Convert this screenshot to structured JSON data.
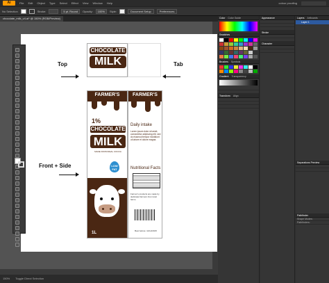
{
  "app": {
    "name": "Ai",
    "workspace_label": "colour proofing"
  },
  "menu": [
    "File",
    "Edit",
    "Object",
    "Type",
    "Select",
    "Effect",
    "View",
    "Window",
    "Help"
  ],
  "controlbar": {
    "selection": "No Selection",
    "stroke_label": "Stroke:",
    "stroke_value": "",
    "uniform_label": "5 pt. Round",
    "opacity_label": "Opacity:",
    "opacity_value": "100%",
    "style_label": "Style:",
    "doc_setup": "Document Setup",
    "preferences": "Preferences"
  },
  "document": {
    "tab_title": "chocolate_milk_v4.ai* @ 150% (RGB/Preview)"
  },
  "labels": {
    "top": "Top",
    "tab": "Tab",
    "front_side": "Front + Side"
  },
  "package": {
    "top_choc": "CHOCOLATE",
    "top_milk": "MILK",
    "brand_left": "FARMER'S",
    "brand_right": "FARMER'S",
    "pct": "1%",
    "front_choc": "CHOCOLATE",
    "front_milk": "MILK",
    "front_note": "MADE FROM REAL COCOA",
    "lowfat": "LOW FAT",
    "volume": "1L",
    "daily": "Daily intake",
    "lorem": "Lorem ipsum dolor sit amet, consectetur adipiscing elit, sed do eiusmod tempor incididunt ut labore et dolore magna.",
    "nutrition": "Nutritional Facts",
    "farmers_text": "Farmer's products are made by dedicated farmers from local farms.",
    "best_before": "Best before: 11/12/2015"
  },
  "panels": {
    "col1_tabs": [
      "Color",
      "Color Guide"
    ],
    "swatches_label": "Swatches",
    "symbols_label": "Symbols",
    "brushes_label": "Brushes",
    "appearance_label": "Appearance",
    "gradient_label": "Gradient",
    "transform_label": "Transform",
    "align_label": "Align",
    "col3_tabs": [
      "Layers",
      "Artboards"
    ],
    "layer_name": "Layer 1",
    "pathfinder_label": "Pathfinder",
    "shape_modes": "Shape Modes:",
    "pathfinders": "Pathfinders:",
    "stroke_label": "Stroke",
    "transparency_label": "Transparency",
    "char_label": "Character",
    "separations": "Separations Preview"
  },
  "status": {
    "zoom": "150%",
    "tool": "Toggle Direct Selection"
  },
  "colors": {
    "chocolate": "#4a2713",
    "lowfat_blue": "#2d8fd0",
    "accent": "#ff9a00"
  }
}
